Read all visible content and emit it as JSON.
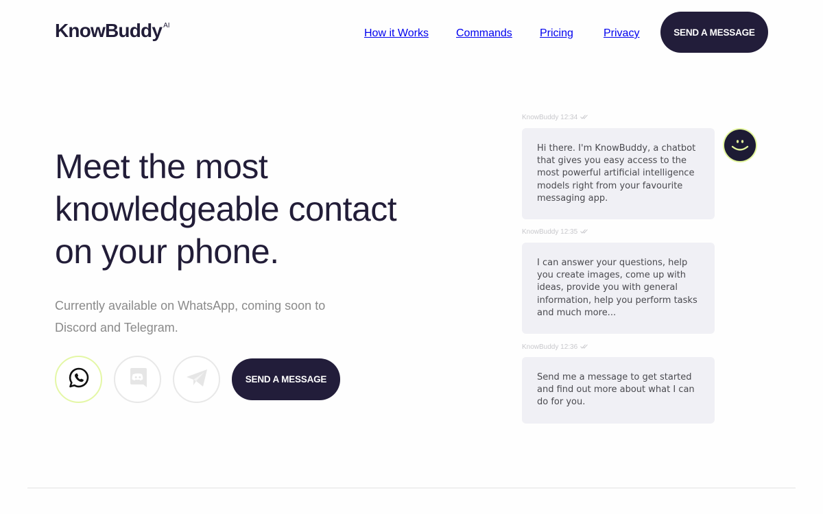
{
  "header": {
    "logo": "KnowBuddy",
    "logo_sup": "AI",
    "nav": [
      {
        "label": "How it Works"
      },
      {
        "label": "Commands"
      },
      {
        "label": "Pricing"
      },
      {
        "label": "Privacy"
      }
    ],
    "cta_label": "SEND A MESSAGE"
  },
  "hero": {
    "title_lines": [
      "Meet the most",
      "knowledgeable contact",
      "on your phone."
    ],
    "subtitle": "Currently available on WhatsApp, coming soon to Discord and Telegram.",
    "platforms": [
      {
        "name": "WhatsApp",
        "icon": "whatsapp-icon",
        "active": true
      },
      {
        "name": "Discord",
        "icon": "discord-icon",
        "active": false
      },
      {
        "name": "Telegram",
        "icon": "telegram-icon",
        "active": false
      }
    ],
    "cta_label": "SEND A MESSAGE"
  },
  "chat": {
    "messages": [
      {
        "meta": "KnowBuddy 12:34",
        "text": "Hi there. I'm KnowBuddy, a chatbot that gives you easy access to the most powerful artificial intelligence models right from your favourite messaging app."
      },
      {
        "meta": "KnowBuddy 12:35",
        "text": "I can answer your questions, help you create images, come up with ideas, provide you with general information, help you perform tasks and much more..."
      },
      {
        "meta": "KnowBuddy 12:36",
        "text": "Send me a message to get started and find out more about what I can do for you."
      }
    ],
    "avatar_icon": "smiley-icon"
  },
  "colors": {
    "brand_dark": "#221d3a",
    "accent_lime": "#e2f59c",
    "bubble_bg": "#f0f0f5"
  }
}
